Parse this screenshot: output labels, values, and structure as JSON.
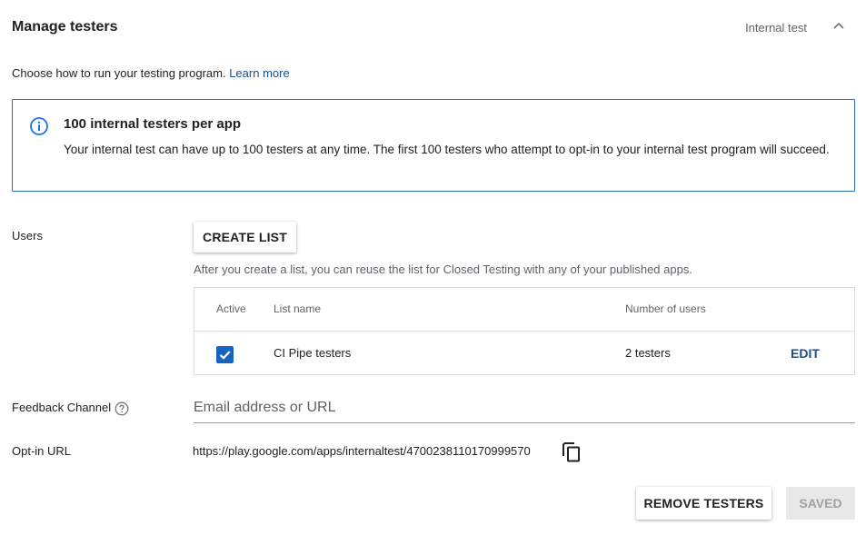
{
  "header": {
    "title": "Manage testers",
    "track_label": "Internal test",
    "toggle_icon": "chevron-up-icon"
  },
  "intro": {
    "text": "Choose how to run your testing program.",
    "link": "Learn more"
  },
  "info_box": {
    "icon": "info-icon",
    "accent_color": "#2a6cb8",
    "title": "100 internal testers per app",
    "text": "Your internal test can have up to 100 testers at any time. The first 100 testers who attempt to opt-in to your internal test program will succeed."
  },
  "users": {
    "label": "Users",
    "create_button": "CREATE LIST",
    "hint": "After you create a list, you can reuse the list for Closed Testing with any of your published apps.",
    "table": {
      "columns": [
        "Active",
        "List name",
        "Number of users"
      ],
      "rows": [
        {
          "active": true,
          "name": "CI Pipe testers",
          "users": "2 testers",
          "action": "EDIT"
        }
      ]
    }
  },
  "feedback": {
    "label": "Feedback Channel",
    "help_icon": "help-circle-icon",
    "placeholder": "Email address or URL",
    "value": ""
  },
  "optin": {
    "label": "Opt-in URL",
    "url": "https://play.google.com/apps/internaltest/4700238110170999570",
    "copy_icon": "copy-icon"
  },
  "footer": {
    "remove_button": "REMOVE TESTERS",
    "saved_button": "SAVED"
  },
  "colors": {
    "link": "#1a4f8a",
    "checkbox": "#1565c0",
    "disabled_bg": "#e8e8e8",
    "disabled_text": "#a0a0a0"
  }
}
